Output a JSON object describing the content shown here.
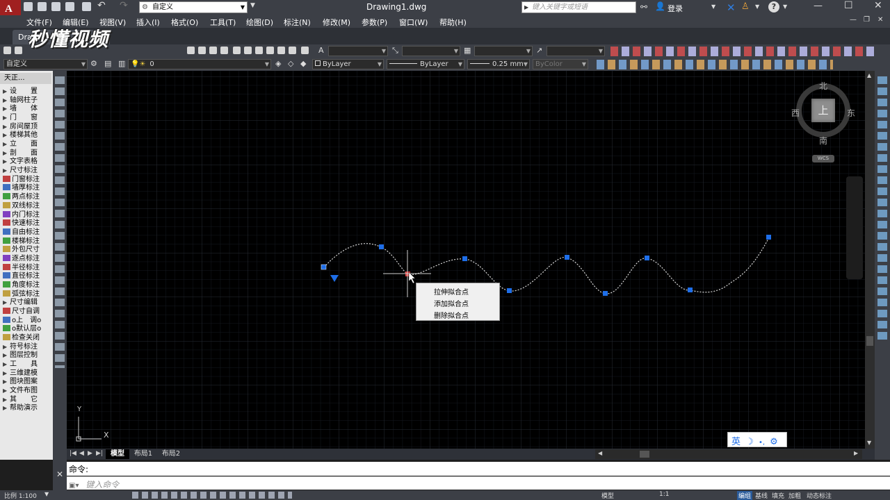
{
  "window": {
    "title": "Drawing1.dwg",
    "workspace": "自定义",
    "search_placeholder": "键入关键字或短语",
    "login": "登录",
    "help": "?"
  },
  "menu": [
    "文件(F)",
    "编辑(E)",
    "视图(V)",
    "插入(I)",
    "格式(O)",
    "工具(T)",
    "绘图(D)",
    "标注(N)",
    "修改(M)",
    "参数(P)",
    "窗口(W)",
    "帮助(H)"
  ],
  "doc_tab": "Draw",
  "watermark": "秒懂视频",
  "layer_combo": "自定义",
  "layer_current": "0",
  "properties": {
    "color": "ByLayer",
    "linetype": "ByLayer",
    "lineweight": "0.25 mm",
    "plotstyle": "ByColor"
  },
  "palette": {
    "header": "天正...",
    "items": [
      {
        "label": "设　　置",
        "arrow": true
      },
      {
        "label": "轴网柱子",
        "arrow": true
      },
      {
        "label": "墙　　体",
        "arrow": true
      },
      {
        "label": "门　　窗",
        "arrow": true
      },
      {
        "label": "房间屋顶",
        "arrow": true
      },
      {
        "label": "楼梯其他",
        "arrow": true
      },
      {
        "label": "立　　面",
        "arrow": true
      },
      {
        "label": "剖　　面",
        "arrow": true
      },
      {
        "label": "文字表格",
        "arrow": true
      },
      {
        "label": "尺寸标注",
        "arrow": true
      },
      {
        "label": "门窗标注",
        "arrow": false
      },
      {
        "label": "墙厚标注",
        "arrow": false
      },
      {
        "label": "两点标注",
        "arrow": false
      },
      {
        "label": "双线标注",
        "arrow": false
      },
      {
        "label": "内门标注",
        "arrow": false
      },
      {
        "label": "快速标注",
        "arrow": false
      },
      {
        "label": "自由标注",
        "arrow": false
      },
      {
        "label": "楼梯标注",
        "arrow": false
      },
      {
        "label": "外包尺寸",
        "arrow": false
      },
      {
        "label": "逐点标注",
        "arrow": false
      },
      {
        "label": "半径标注",
        "arrow": false
      },
      {
        "label": "直径标注",
        "arrow": false
      },
      {
        "label": "角度标注",
        "arrow": false
      },
      {
        "label": "弧弦标注",
        "arrow": false
      },
      {
        "label": "尺寸编辑",
        "arrow": true
      },
      {
        "label": "尺寸自调",
        "arrow": false
      },
      {
        "label": "o上　调o",
        "arrow": false
      },
      {
        "label": "o默认层o",
        "arrow": false
      },
      {
        "label": "检查关闭",
        "arrow": false
      },
      {
        "label": "符号标注",
        "arrow": true
      },
      {
        "label": "图层控制",
        "arrow": true
      },
      {
        "label": "工　　具",
        "arrow": true
      },
      {
        "label": "三维建模",
        "arrow": true
      },
      {
        "label": "图块图案",
        "arrow": true
      },
      {
        "label": "文件布图",
        "arrow": true
      },
      {
        "label": "其　　它",
        "arrow": true
      },
      {
        "label": "帮助演示",
        "arrow": true
      }
    ]
  },
  "viewcube": {
    "north": "北",
    "south": "南",
    "east": "东",
    "west": "西",
    "top": "上",
    "wcs": "WCS"
  },
  "ucs": {
    "x": "X",
    "y": "Y"
  },
  "context_menu": [
    "拉伸拟合点",
    "添加拟合点",
    "删除拟合点"
  ],
  "ime": {
    "lang": "英"
  },
  "layout_tabs": [
    "模型",
    "布局1",
    "布局2"
  ],
  "command": {
    "label": "命令:",
    "placeholder": "键入命令"
  },
  "status": {
    "scale": "比例 1:100",
    "model": "模型",
    "annotation_scale": "1:1",
    "items": [
      "编组",
      "基线",
      "填充",
      "加粗",
      "动态标注"
    ]
  }
}
